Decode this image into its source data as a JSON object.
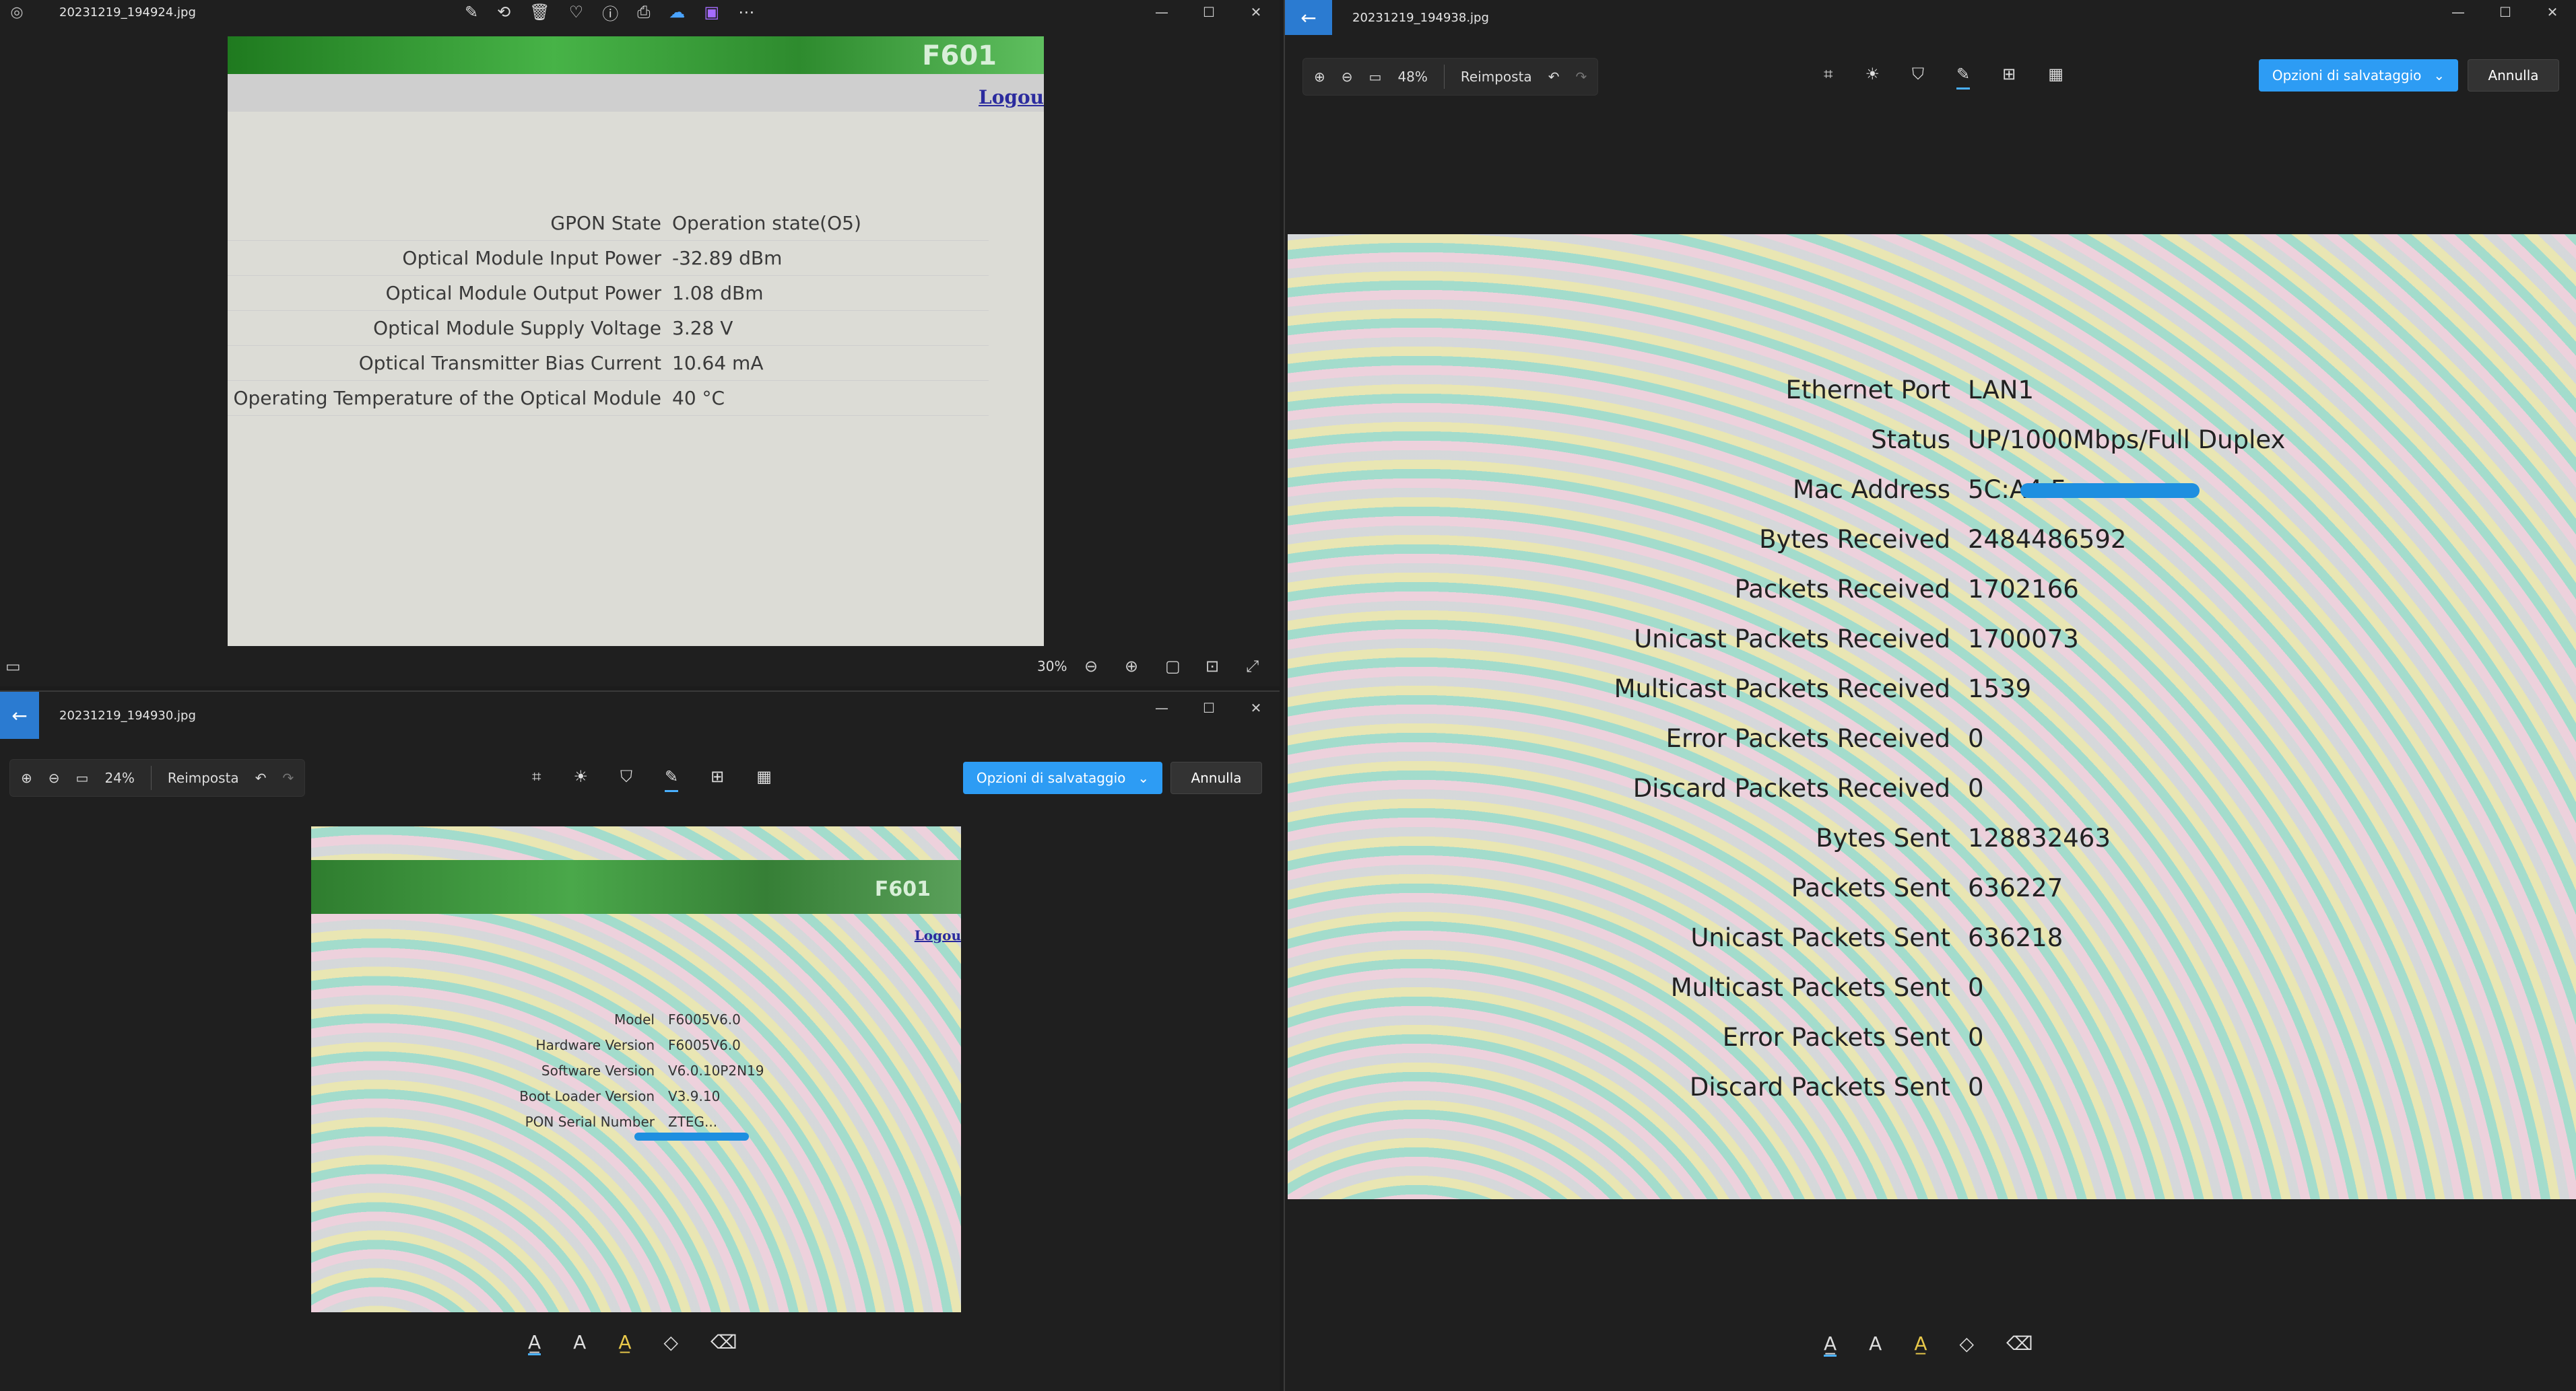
{
  "window_top_left": {
    "title": "20231219_194924.jpg",
    "zoom": "30%",
    "router_model": "F601",
    "logout": "Logou",
    "rows": [
      {
        "label": "GPON State",
        "value": "Operation state(O5)"
      },
      {
        "label": "Optical Module Input Power",
        "value": "-32.89 dBm"
      },
      {
        "label": "Optical Module Output Power",
        "value": "1.08 dBm"
      },
      {
        "label": "Optical Module Supply Voltage",
        "value": "3.28 V"
      },
      {
        "label": "Optical Transmitter Bias Current",
        "value": "10.64 mA"
      },
      {
        "label": "Operating Temperature of the Optical Module",
        "value": "40 °C"
      }
    ]
  },
  "window_bottom_left": {
    "title": "20231219_194930.jpg",
    "zoom": "24%",
    "reset": "Reimposta",
    "save_options": "Opzioni di salvataggio",
    "cancel": "Annulla",
    "router_model": "F601",
    "logout": "Logou",
    "rows": [
      {
        "label": "Model",
        "value": "F6005V6.0"
      },
      {
        "label": "Hardware Version",
        "value": "F6005V6.0"
      },
      {
        "label": "Software Version",
        "value": "V6.0.10P2N19"
      },
      {
        "label": "Boot Loader Version",
        "value": "V3.9.10"
      },
      {
        "label": "PON Serial Number",
        "value": "ZTEG..."
      }
    ]
  },
  "window_right": {
    "title": "20231219_194938.jpg",
    "zoom": "48%",
    "reset": "Reimposta",
    "save_options": "Opzioni di salvataggio",
    "cancel": "Annulla",
    "rows": [
      {
        "label": "Ethernet Port",
        "value": "LAN1"
      },
      {
        "label": "Status",
        "value": "UP/1000Mbps/Full Duplex"
      },
      {
        "label": "Mac Address",
        "value": "5C:A4:F"
      },
      {
        "label": "Bytes Received",
        "value": "2484486592"
      },
      {
        "label": "Packets Received",
        "value": "1702166"
      },
      {
        "label": "Unicast Packets Received",
        "value": "1700073"
      },
      {
        "label": "Multicast Packets Received",
        "value": "1539"
      },
      {
        "label": "Error Packets Received",
        "value": "0"
      },
      {
        "label": "Discard Packets Received",
        "value": "0"
      },
      {
        "label": "Bytes Sent",
        "value": "128832463"
      },
      {
        "label": "Packets Sent",
        "value": "636227"
      },
      {
        "label": "Unicast Packets Sent",
        "value": "636218"
      },
      {
        "label": "Multicast Packets Sent",
        "value": "0"
      },
      {
        "label": "Error Packets Sent",
        "value": "0"
      },
      {
        "label": "Discard Packets Sent",
        "value": "0"
      }
    ]
  },
  "icons": {
    "minimize": "—",
    "maximize": "☐",
    "close": "✕",
    "back": "←"
  },
  "colors": {
    "accent": "#2d9cf4",
    "router_header_green": "#2e8b2e"
  }
}
